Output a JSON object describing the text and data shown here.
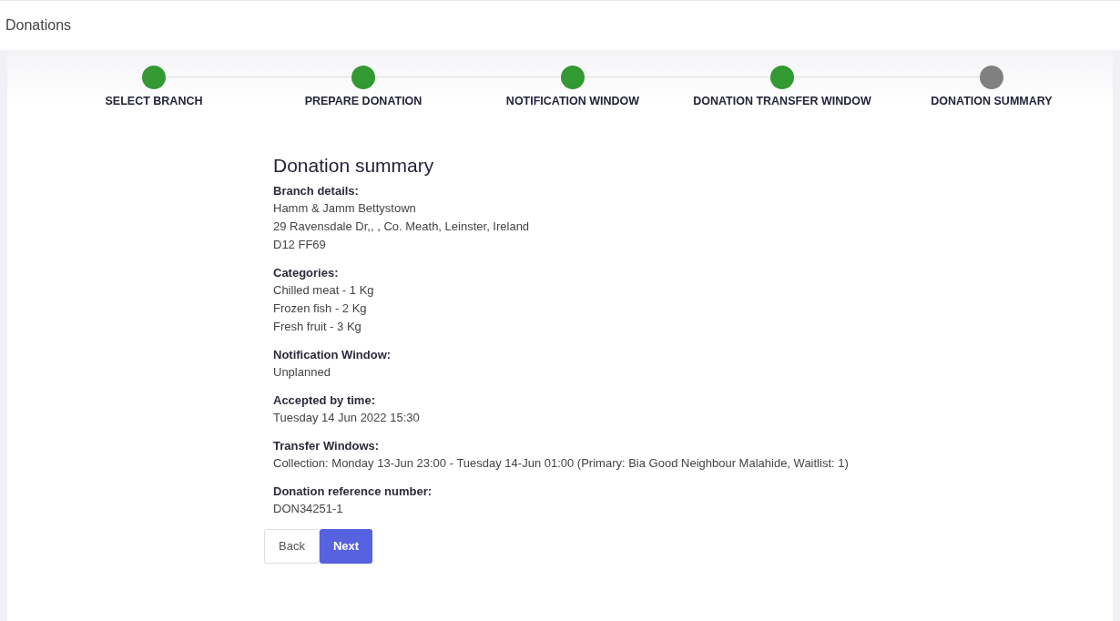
{
  "header": {
    "title": "Donations"
  },
  "steps": [
    {
      "label": "SELECT BRANCH",
      "completed": true
    },
    {
      "label": "PREPARE DONATION",
      "completed": true
    },
    {
      "label": "NOTIFICATION WINDOW",
      "completed": true
    },
    {
      "label": "DONATION TRANSFER WINDOW",
      "completed": true
    },
    {
      "label": "DONATION SUMMARY",
      "completed": false
    }
  ],
  "summary": {
    "title": "Donation summary",
    "sections": [
      {
        "heading": "Branch details:",
        "lines": [
          "Hamm & Jamm Bettystown",
          "29 Ravensdale Dr,, , Co. Meath, Leinster, Ireland",
          "D12 FF69"
        ]
      },
      {
        "heading": "Categories:",
        "lines": [
          "Chilled meat - 1 Kg",
          "Frozen fish - 2 Kg",
          "Fresh fruit - 3 Kg"
        ]
      },
      {
        "heading": "Notification Window:",
        "lines": [
          "Unplanned"
        ]
      },
      {
        "heading": "Accepted by time:",
        "lines": [
          "Tuesday 14 Jun 2022 15:30"
        ]
      },
      {
        "heading": "Transfer Windows:",
        "lines": [
          "Collection: Monday 13-Jun 23:00 - Tuesday 14-Jun 01:00 (Primary: Bia Good Neighbour Malahide, Waitlist: 1)"
        ]
      },
      {
        "heading": "Donation reference number:",
        "lines": [
          "DON34251-1"
        ]
      }
    ]
  },
  "buttons": [
    {
      "label": "Back",
      "kind": "secondary"
    },
    {
      "label": "Next",
      "kind": "primary"
    }
  ]
}
